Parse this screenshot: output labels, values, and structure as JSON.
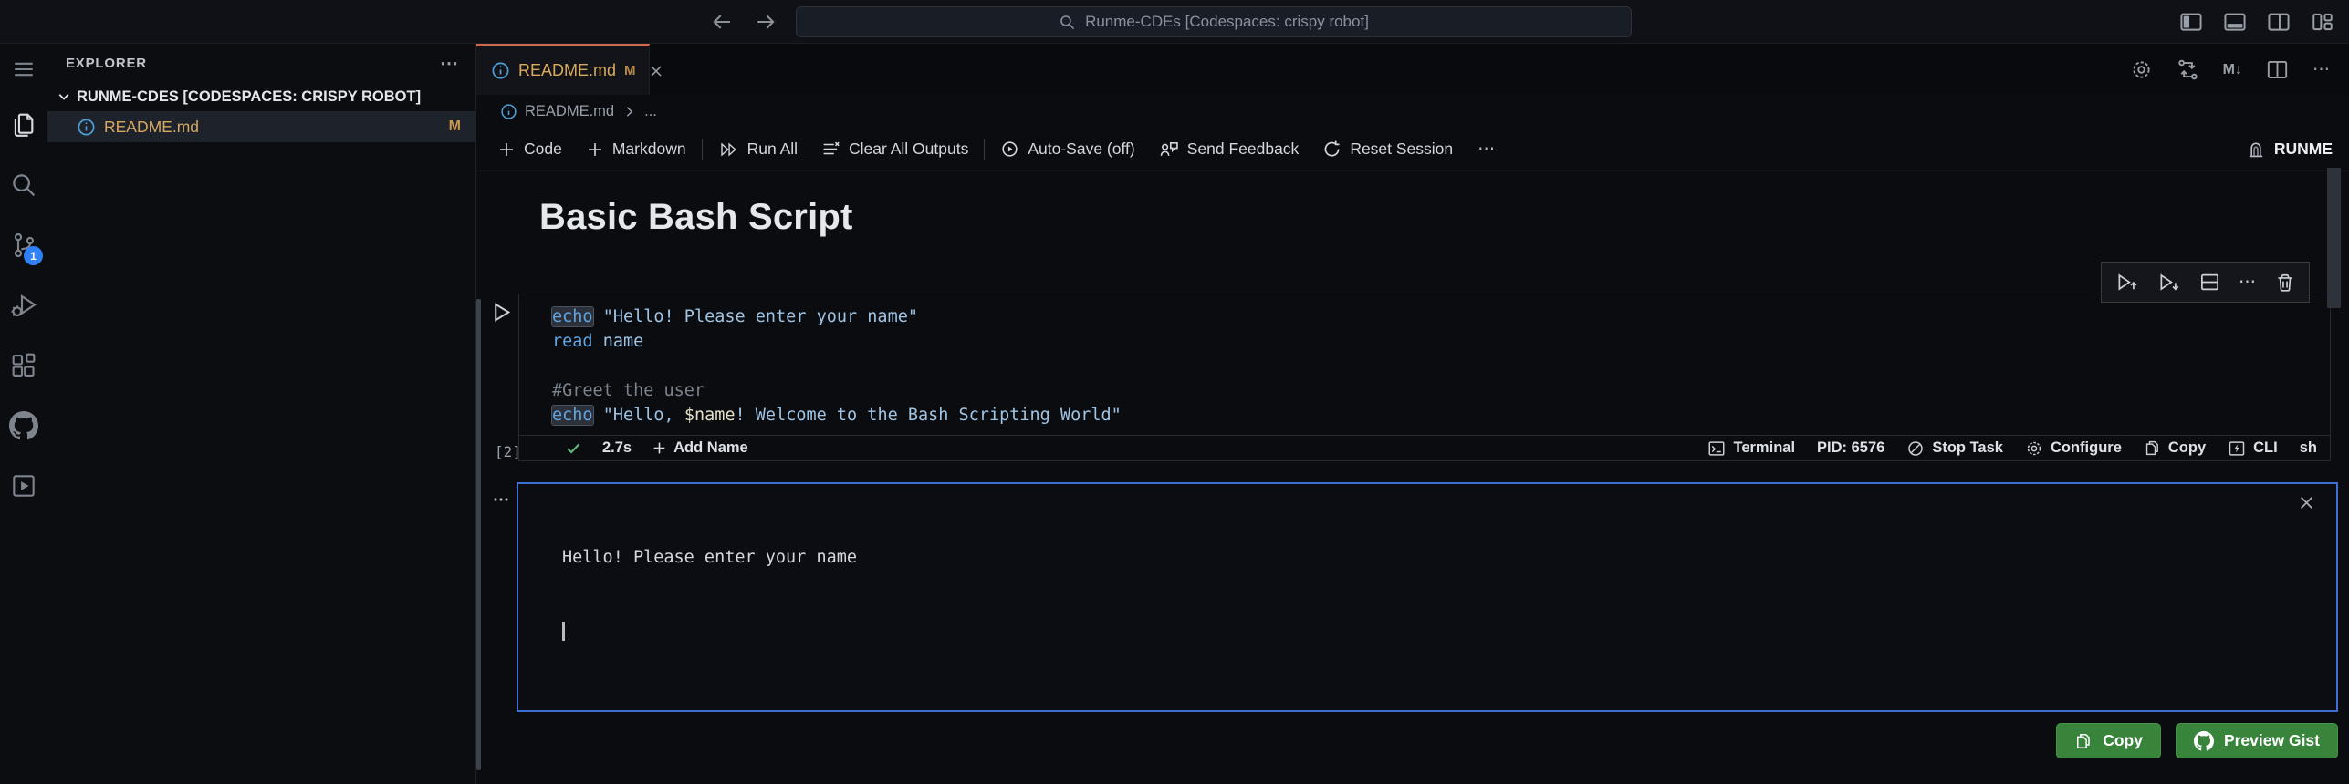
{
  "title_bar": {
    "search_text": "Runme-CDEs [Codespaces: crispy robot]"
  },
  "activity_bar": {
    "scm_badge": "1"
  },
  "sidebar": {
    "title": "EXPLORER",
    "more": "⋯",
    "section_label": "RUNME-CDES [CODESPACES: CRISPY ROBOT]",
    "file": {
      "name": "README.md",
      "badge": "M"
    }
  },
  "tab": {
    "label": "README.md",
    "badge": "M"
  },
  "editor_actions": {
    "markdown_export": "M↓"
  },
  "breadcrumb": {
    "file": "README.md",
    "ellipsis": "..."
  },
  "toolbar": {
    "code": "Code",
    "markdown": "Markdown",
    "run_all": "Run All",
    "clear_all": "Clear All Outputs",
    "auto_save": "Auto-Save (off)",
    "send_feedback": "Send Feedback",
    "reset_session": "Reset Session",
    "more": "⋯",
    "kernel": "RUNME"
  },
  "notebook": {
    "heading": "Basic Bash Script"
  },
  "cell": {
    "exec_order": "[2]",
    "code": [
      [
        {
          "t": "echo",
          "c": "kw hl"
        },
        {
          "t": " ",
          "c": "pl"
        },
        {
          "t": "\"Hello! Please enter your name\"",
          "c": "str"
        }
      ],
      [
        {
          "t": "read",
          "c": "kw"
        },
        {
          "t": " ",
          "c": "pl"
        },
        {
          "t": "name",
          "c": "str"
        }
      ],
      [],
      [
        {
          "t": "#Greet the user",
          "c": "cmt"
        }
      ],
      [
        {
          "t": "echo",
          "c": "kw hl"
        },
        {
          "t": " ",
          "c": "pl"
        },
        {
          "t": "\"Hello, ",
          "c": "str"
        },
        {
          "t": "$name",
          "c": "var"
        },
        {
          "t": "! Welcome to the Bash Scripting World\"",
          "c": "str"
        }
      ]
    ],
    "status": {
      "duration": "2.7s",
      "add_name": "Add Name",
      "terminal": "Terminal",
      "pid": "PID: 6576",
      "stop_task": "Stop Task",
      "configure": "Configure",
      "copy": "Copy",
      "cli": "CLI",
      "lang": "sh"
    }
  },
  "output": {
    "gutter_more": "⋯",
    "line1": "Hello! Please enter your name"
  },
  "gist_actions": {
    "copy": "Copy",
    "preview": "Preview Gist"
  }
}
